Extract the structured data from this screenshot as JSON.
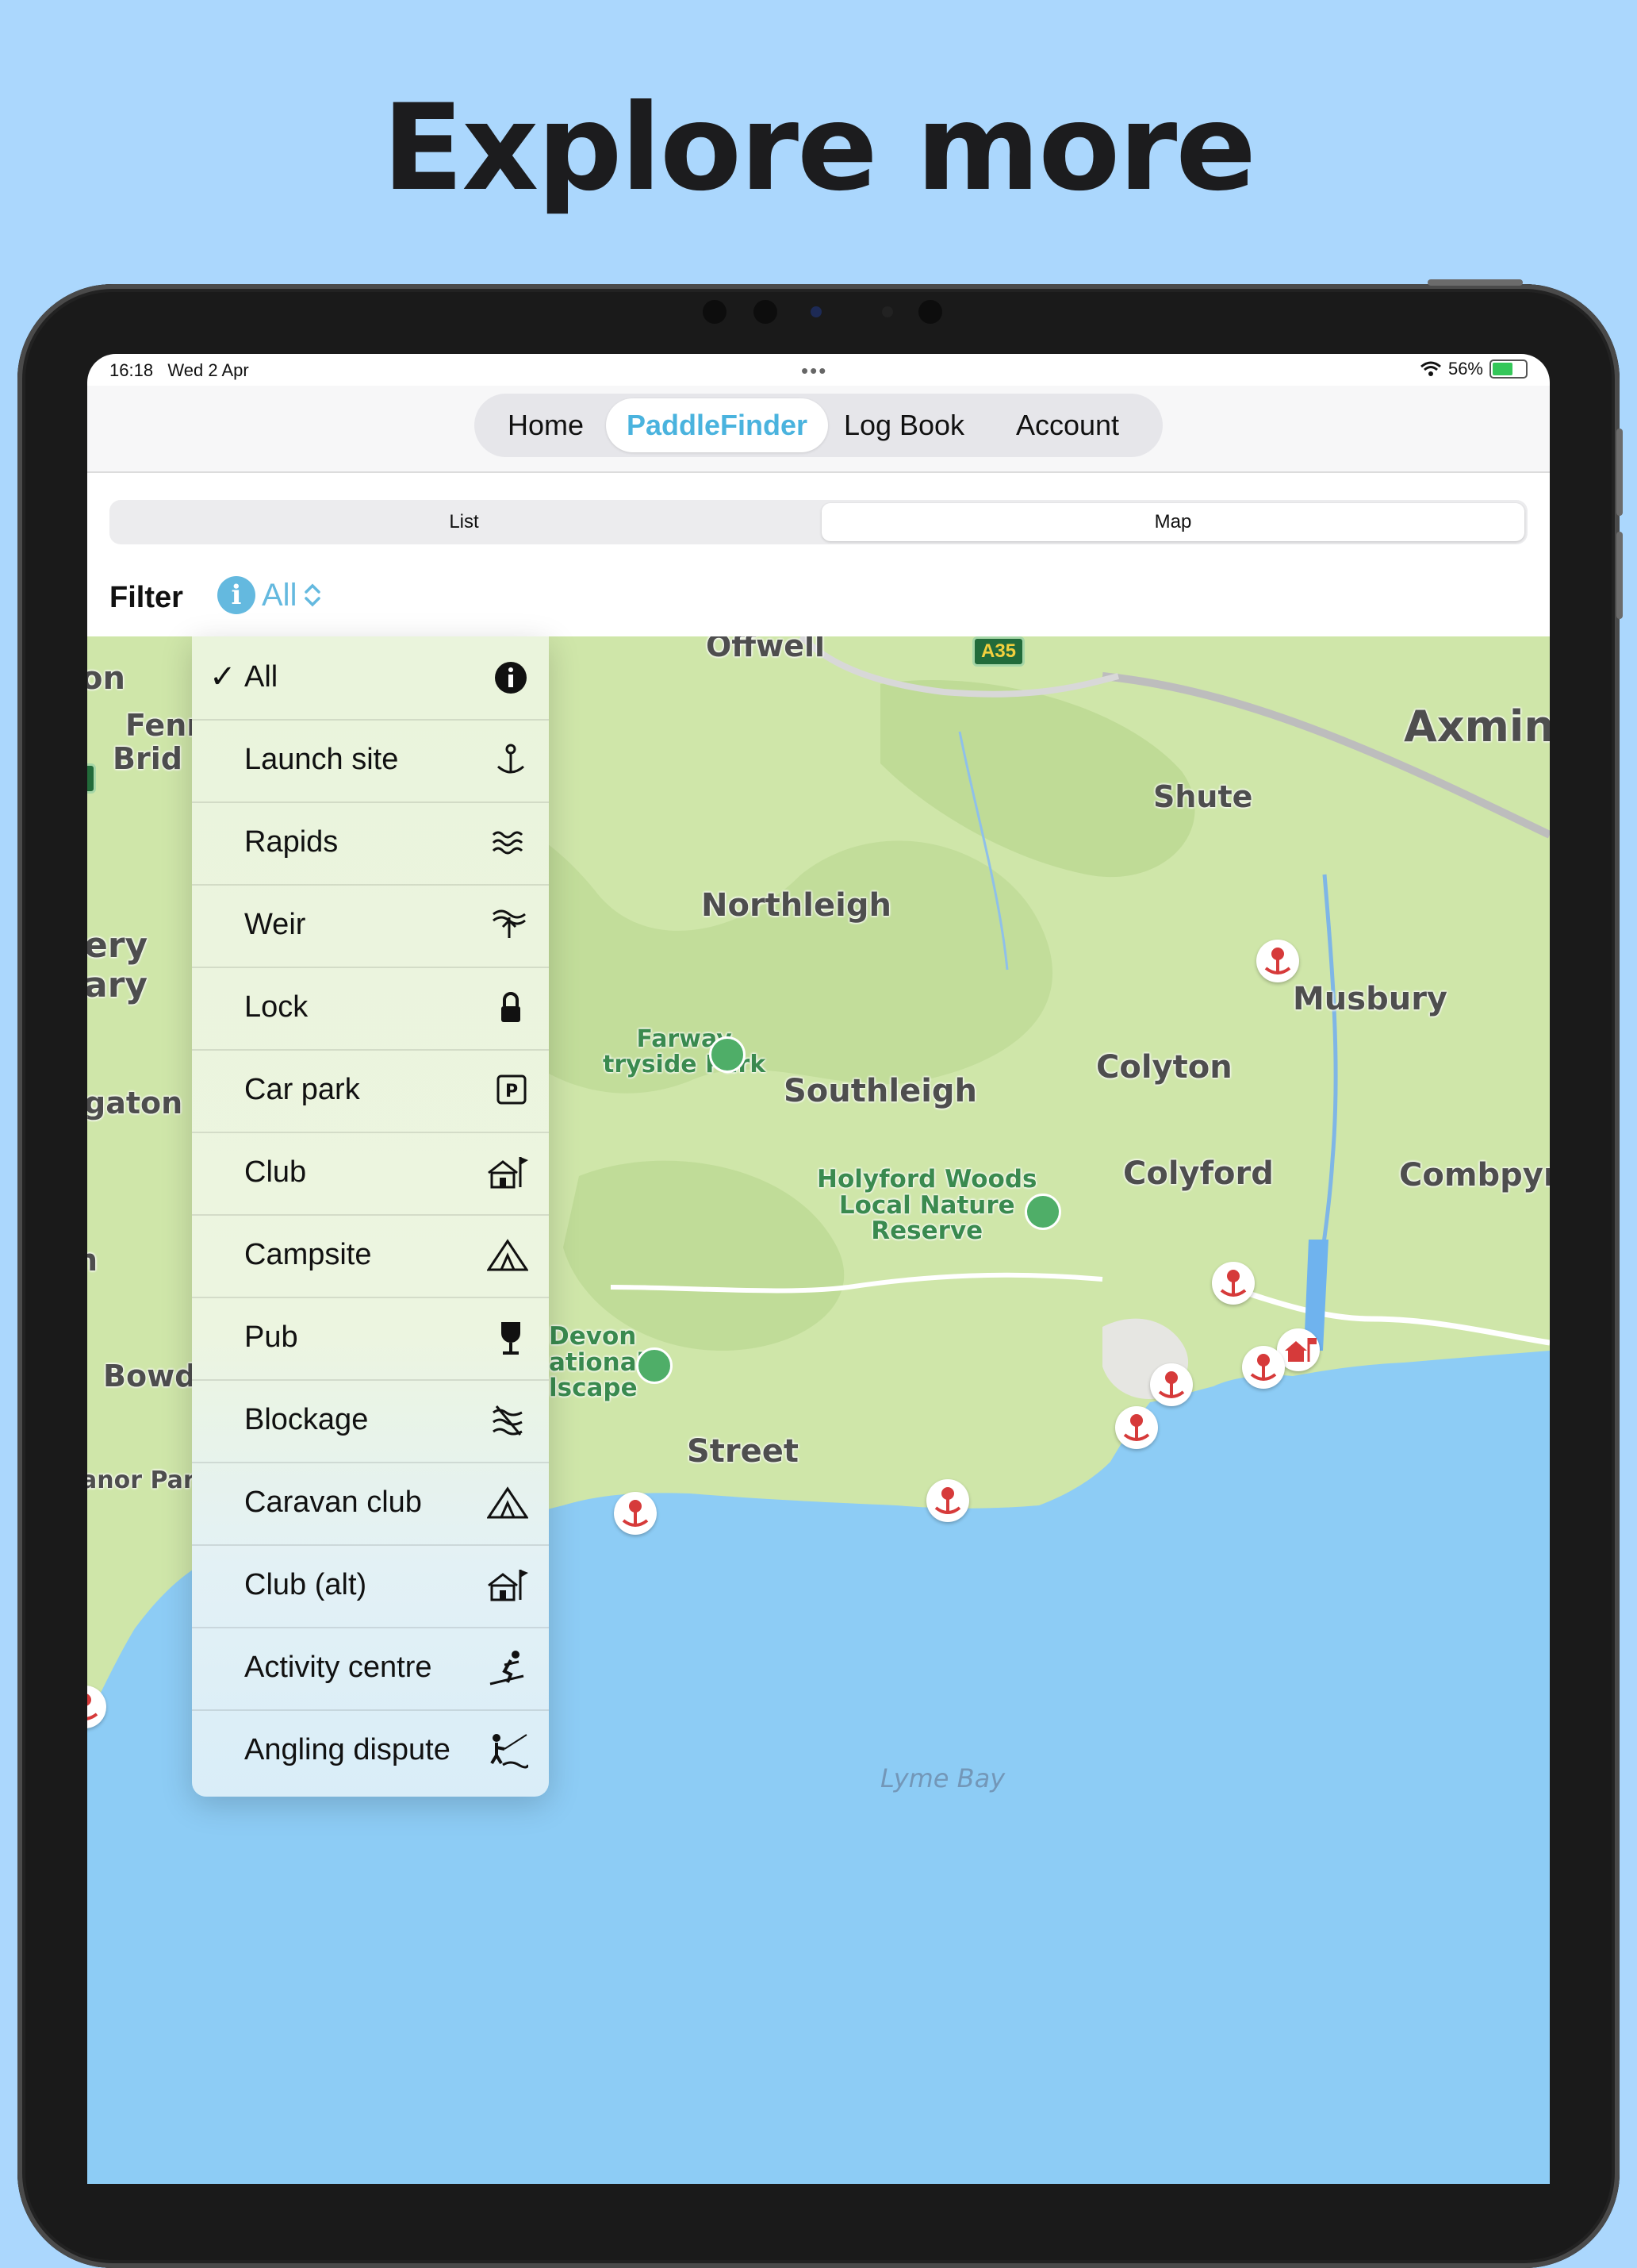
{
  "headline": "Explore more",
  "status": {
    "time": "16:18",
    "date": "Wed 2 Apr",
    "battery": "56%"
  },
  "nav_tabs": [
    {
      "label": "Home"
    },
    {
      "label": "PaddleFinder"
    },
    {
      "label": "Log Book"
    },
    {
      "label": "Account"
    }
  ],
  "active_tab": "PaddleFinder",
  "view_toggle": {
    "list": "List",
    "map": "Map",
    "selected": "Map"
  },
  "filter": {
    "label": "Filter",
    "value": "All"
  },
  "filter_menu": [
    {
      "label": "All",
      "icon": "info-circle-icon",
      "checked": true
    },
    {
      "label": "Launch site",
      "icon": "launch-site-icon"
    },
    {
      "label": "Rapids",
      "icon": "rapids-icon"
    },
    {
      "label": "Weir",
      "icon": "weir-icon"
    },
    {
      "label": "Lock",
      "icon": "lock-icon"
    },
    {
      "label": "Car park",
      "icon": "car-park-icon"
    },
    {
      "label": "Club",
      "icon": "club-icon"
    },
    {
      "label": "Campsite",
      "icon": "campsite-icon"
    },
    {
      "label": "Pub",
      "icon": "pub-icon"
    },
    {
      "label": "Blockage",
      "icon": "blockage-icon"
    },
    {
      "label": "Caravan club",
      "icon": "caravan-club-icon"
    },
    {
      "label": "Club (alt)",
      "icon": "club-alt-icon"
    },
    {
      "label": "Activity centre",
      "icon": "activity-centre-icon"
    },
    {
      "label": "Angling dispute",
      "icon": "angling-dispute-icon"
    }
  ],
  "map_labels": {
    "offwell": "Offwell",
    "axminster": "Axmins",
    "shute": "Shute",
    "northleigh": "Northleigh",
    "musbury": "Musbury",
    "colyton": "Colyton",
    "southleigh": "Southleigh",
    "colyford": "Colyford",
    "combpyne": "Combpyn",
    "street": "Street",
    "fenny": "Fenn",
    "bridge": "Brid",
    "ery": "ery",
    "ary": "ary",
    "gaton": "gaton",
    "bowd": "Bowd",
    "on": "on",
    "n": "n",
    "anor_park": "anor Park",
    "lyme_bay": "Lyme Bay",
    "farway": "Farway",
    "countryside_park": "tryside Park",
    "holyford": [
      "Holyford Woods",
      "Local Nature",
      "Reserve"
    ],
    "devon": [
      "Devon",
      "ational",
      "lscape"
    ],
    "road_a35": "A35",
    "road_small": "0"
  },
  "colors": {
    "background": "#abd7fd",
    "accent": "#64b9df",
    "land": "#cfe6a9",
    "sea": "#8dccf5",
    "pin": "#d63a3a"
  }
}
